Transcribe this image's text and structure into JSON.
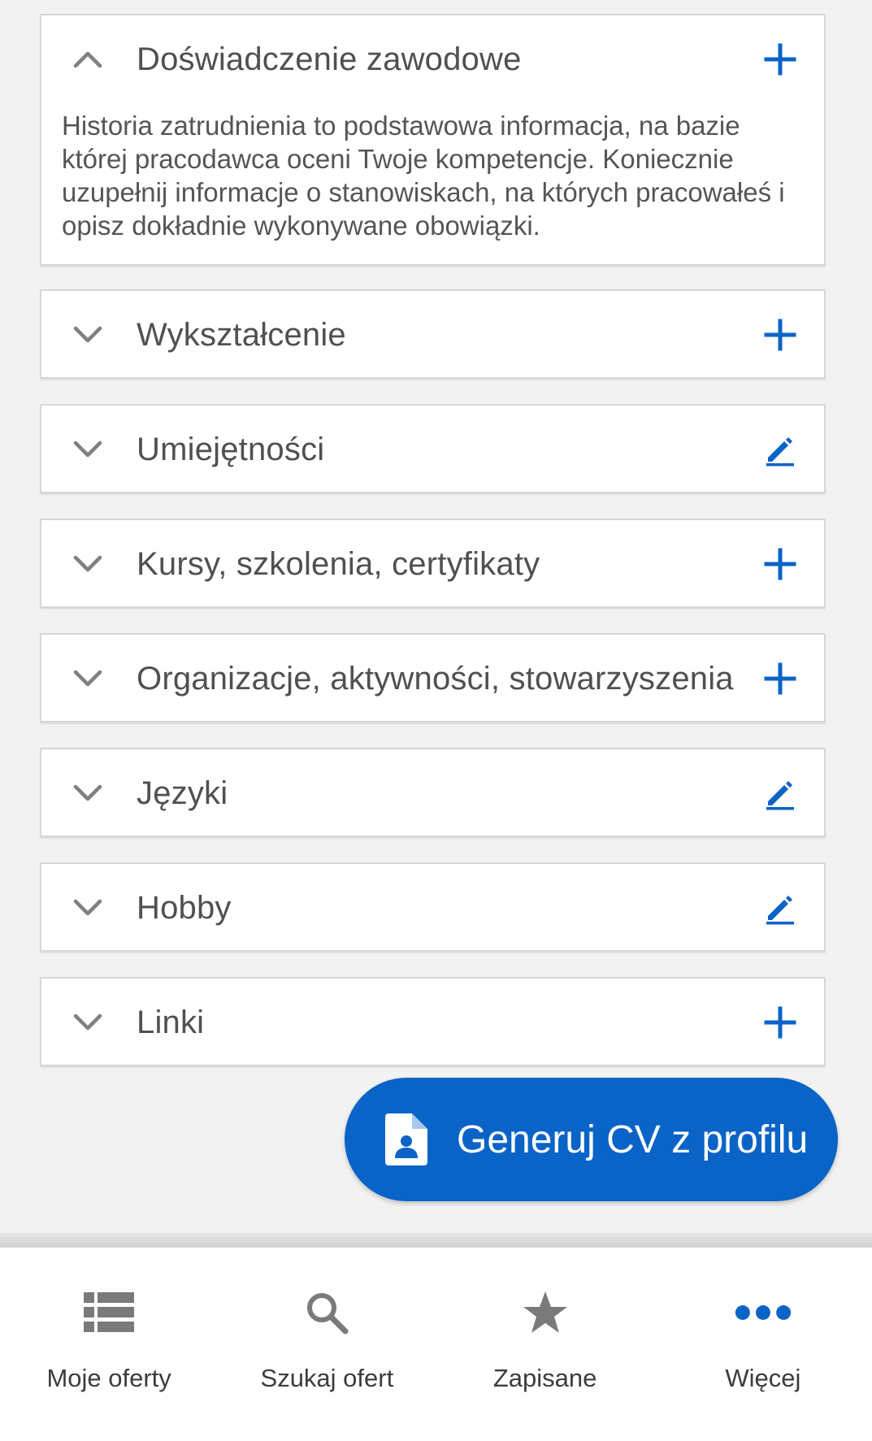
{
  "colors": {
    "accent": "#0a63c7",
    "icon_grey": "#808080",
    "background": "#f2f2f2"
  },
  "sections": [
    {
      "title": "Doświadczenie zawodowe",
      "expanded": true,
      "action": "plus-icon",
      "description": "Historia zatrudnienia to podstawowa informacja, na bazie której pracodawca oceni Twoje kompetencje. Koniecznie uzupełnij informacje o stanowiskach, na których pracowałeś i opisz dokładnie wykonywane obowiązki."
    },
    {
      "title": "Wykształcenie",
      "expanded": false,
      "action": "plus-icon"
    },
    {
      "title": "Umiejętności",
      "expanded": false,
      "action": "pencil-icon"
    },
    {
      "title": "Kursy, szkolenia, certyfikaty",
      "expanded": false,
      "action": "plus-icon"
    },
    {
      "title": "Organizacje, aktywności, stowarzyszenia",
      "expanded": false,
      "action": "plus-icon"
    },
    {
      "title": "Języki",
      "expanded": false,
      "action": "pencil-icon"
    },
    {
      "title": "Hobby",
      "expanded": false,
      "action": "pencil-icon"
    },
    {
      "title": "Linki",
      "expanded": false,
      "action": "plus-icon"
    }
  ],
  "cta": {
    "label": "Generuj CV z profilu",
    "icon": "document-user-icon"
  },
  "bottom_nav": [
    {
      "label": "Moje oferty",
      "icon": "list-icon"
    },
    {
      "label": "Szukaj ofert",
      "icon": "search-icon"
    },
    {
      "label": "Zapisane",
      "icon": "star-icon"
    },
    {
      "label": "Więcej",
      "icon": "more-dots-icon"
    }
  ]
}
